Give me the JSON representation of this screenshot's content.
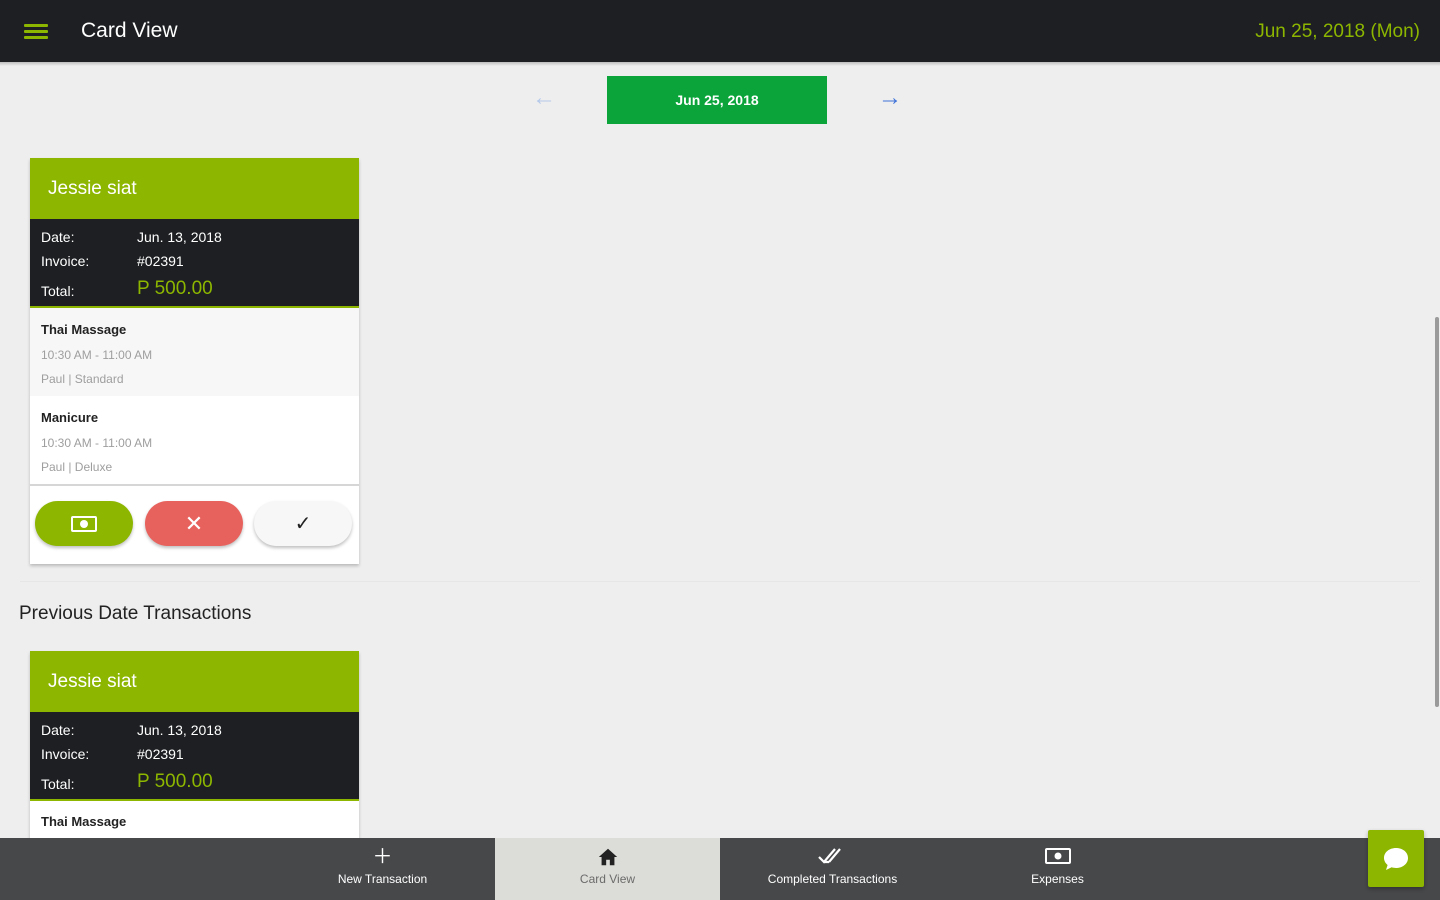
{
  "header": {
    "title": "Card View",
    "date": "Jun 25, 2018 (Mon)"
  },
  "date_nav": {
    "current_date": "Jun 25, 2018"
  },
  "labels": {
    "date": "Date:",
    "invoice": "Invoice:",
    "total": "Total:"
  },
  "current_cards": [
    {
      "customer": "Jessie siat",
      "date": "Jun. 13, 2018",
      "invoice": "#02391",
      "total": "P 500.00",
      "services": [
        {
          "name": "Thai Massage",
          "time": "10:30 AM - 11:00 AM",
          "staff": "Paul | Standard"
        },
        {
          "name": "Manicure",
          "time": "10:30 AM - 11:00 AM",
          "staff": "Paul | Deluxe"
        }
      ]
    }
  ],
  "previous_section": {
    "title": "Previous Date Transactions"
  },
  "previous_cards": [
    {
      "customer": "Jessie siat",
      "date": "Jun. 13, 2018",
      "invoice": "#02391",
      "total": "P 500.00",
      "services": [
        {
          "name": "Thai Massage"
        }
      ]
    }
  ],
  "bottom_nav": [
    {
      "label": "New Transaction",
      "icon": "plus-icon"
    },
    {
      "label": "Card View",
      "icon": "home-icon",
      "active": true
    },
    {
      "label": "Completed Transactions",
      "icon": "double-check-icon"
    },
    {
      "label": "Expenses",
      "icon": "cash-icon"
    }
  ],
  "colors": {
    "accent": "#8db600",
    "topbar": "#1d1f22",
    "date_button": "#0aa43b",
    "cancel": "#e8625d",
    "bottom_nav": "#47484a"
  }
}
